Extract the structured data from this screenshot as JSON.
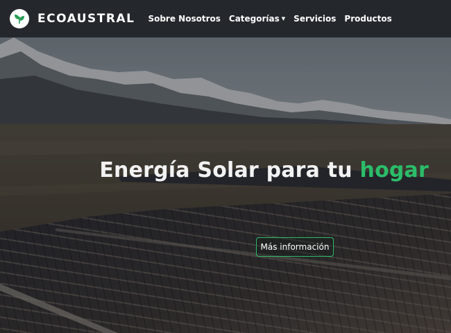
{
  "nav": {
    "brand": "ECOAUSTRAL",
    "links": [
      {
        "label": "Sobre Nosotros"
      },
      {
        "label": "Categorías",
        "has_dropdown": true
      },
      {
        "label": "Servicios"
      },
      {
        "label": "Productos"
      }
    ]
  },
  "hero": {
    "title_main": "Energía Solar para tu ",
    "title_accent": "hogar",
    "cta_label": "Más información"
  },
  "colors": {
    "accent": "#2bbd6a",
    "navbar": "#24282c"
  },
  "icons": {
    "logo": "leaf-logo-icon",
    "dropdown": "caret-down-icon"
  }
}
